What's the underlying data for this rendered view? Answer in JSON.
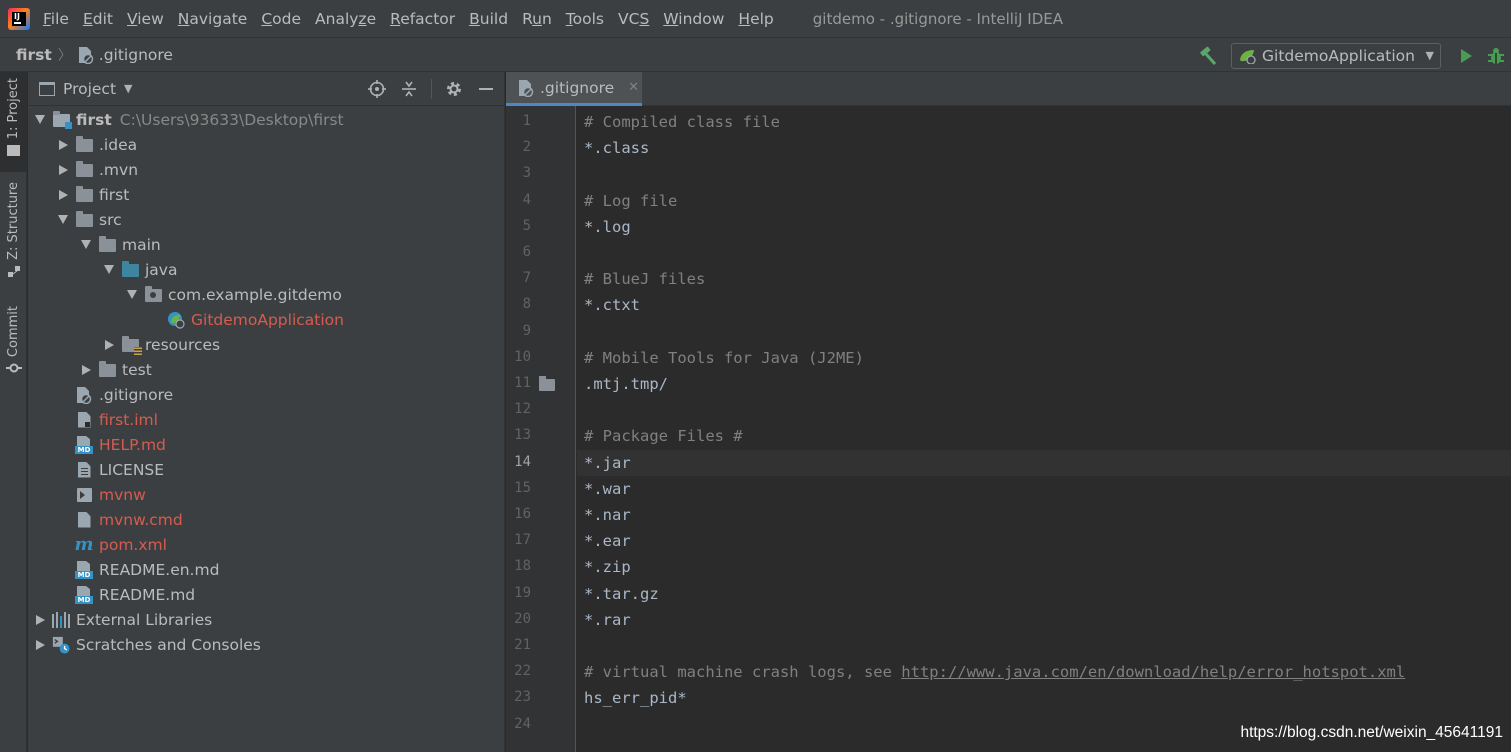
{
  "menubar": {
    "items": [
      {
        "pre": "",
        "mn": "F",
        "post": "ile"
      },
      {
        "pre": "",
        "mn": "E",
        "post": "dit"
      },
      {
        "pre": "",
        "mn": "V",
        "post": "iew"
      },
      {
        "pre": "",
        "mn": "N",
        "post": "avigate"
      },
      {
        "pre": "",
        "mn": "C",
        "post": "ode"
      },
      {
        "pre": "Analy",
        "mn": "z",
        "post": "e"
      },
      {
        "pre": "",
        "mn": "R",
        "post": "efactor"
      },
      {
        "pre": "",
        "mn": "B",
        "post": "uild"
      },
      {
        "pre": "R",
        "mn": "u",
        "post": "n"
      },
      {
        "pre": "",
        "mn": "T",
        "post": "ools"
      },
      {
        "pre": "VC",
        "mn": "S",
        "post": ""
      },
      {
        "pre": "",
        "mn": "W",
        "post": "indow"
      },
      {
        "pre": "",
        "mn": "H",
        "post": "elp"
      }
    ],
    "window_title": "gitdemo - .gitignore - IntelliJ IDEA"
  },
  "navbar": {
    "root": "first",
    "file": ".gitignore",
    "run_config": "GitdemoApplication"
  },
  "toolstripe": {
    "project": "1: Project",
    "structure": "Z: Structure",
    "commit": "Commit"
  },
  "project_panel": {
    "title": "Project",
    "tree": [
      {
        "label": "first",
        "path": "C:\\Users\\93633\\Desktop\\first",
        "depth": 0,
        "arrow": "down",
        "icon": "module-folder-icon",
        "bold": true
      },
      {
        "label": ".idea",
        "depth": 1,
        "arrow": "right",
        "icon": "folder-icon"
      },
      {
        "label": ".mvn",
        "depth": 1,
        "arrow": "right",
        "icon": "folder-icon"
      },
      {
        "label": "first",
        "depth": 1,
        "arrow": "right",
        "icon": "folder-icon"
      },
      {
        "label": "src",
        "depth": 1,
        "arrow": "down",
        "icon": "folder-icon"
      },
      {
        "label": "main",
        "depth": 2,
        "arrow": "down",
        "icon": "folder-icon"
      },
      {
        "label": "java",
        "depth": 3,
        "arrow": "down",
        "icon": "source-folder-icon"
      },
      {
        "label": "com.example.gitdemo",
        "depth": 4,
        "arrow": "down",
        "icon": "package-icon"
      },
      {
        "label": "GitdemoApplication",
        "depth": 5,
        "arrow": "none",
        "icon": "spring-class-icon",
        "red": true
      },
      {
        "label": "resources",
        "depth": 3,
        "arrow": "right",
        "icon": "resources-folder-icon"
      },
      {
        "label": "test",
        "depth": 2,
        "arrow": "right",
        "icon": "folder-icon"
      },
      {
        "label": ".gitignore",
        "depth": 1,
        "arrow": "none",
        "icon": "ignore-file-icon"
      },
      {
        "label": "first.iml",
        "depth": 1,
        "arrow": "none",
        "icon": "iml-file-icon",
        "red": true
      },
      {
        "label": "HELP.md",
        "depth": 1,
        "arrow": "none",
        "icon": "markdown-icon",
        "red": true
      },
      {
        "label": "LICENSE",
        "depth": 1,
        "arrow": "none",
        "icon": "text-file-icon"
      },
      {
        "label": "mvnw",
        "depth": 1,
        "arrow": "none",
        "icon": "shell-script-icon",
        "red": true
      },
      {
        "label": "mvnw.cmd",
        "depth": 1,
        "arrow": "none",
        "icon": "file-icon",
        "red": true
      },
      {
        "label": "pom.xml",
        "depth": 1,
        "arrow": "none",
        "icon": "maven-icon",
        "red": true
      },
      {
        "label": "README.en.md",
        "depth": 1,
        "arrow": "none",
        "icon": "markdown-icon"
      },
      {
        "label": "README.md",
        "depth": 1,
        "arrow": "none",
        "icon": "markdown-icon"
      },
      {
        "label": "External Libraries",
        "depth": 0,
        "arrow": "right",
        "icon": "library-icon"
      },
      {
        "label": "Scratches and Consoles",
        "depth": 0,
        "arrow": "right",
        "icon": "scratches-icon"
      }
    ]
  },
  "editor": {
    "tab_label": ".gitignore",
    "current_line": 14,
    "lines": [
      {
        "text": "# Compiled class file",
        "type": "comment"
      },
      {
        "text": "*.class",
        "type": "code"
      },
      {
        "text": "",
        "type": "code"
      },
      {
        "text": "# Log file",
        "type": "comment"
      },
      {
        "text": "*.log",
        "type": "code"
      },
      {
        "text": "",
        "type": "code"
      },
      {
        "text": "# BlueJ files",
        "type": "comment"
      },
      {
        "text": "*.ctxt",
        "type": "code"
      },
      {
        "text": "",
        "type": "code"
      },
      {
        "text": "# Mobile Tools for Java (J2ME)",
        "type": "comment"
      },
      {
        "text": ".mtj.tmp/",
        "type": "code"
      },
      {
        "text": "",
        "type": "code"
      },
      {
        "text": "# Package Files #",
        "type": "comment"
      },
      {
        "text": "*.jar",
        "type": "code"
      },
      {
        "text": "*.war",
        "type": "code"
      },
      {
        "text": "*.nar",
        "type": "code"
      },
      {
        "text": "*.ear",
        "type": "code"
      },
      {
        "text": "*.zip",
        "type": "code"
      },
      {
        "text": "*.tar.gz",
        "type": "code"
      },
      {
        "text": "*.rar",
        "type": "code"
      },
      {
        "text": "",
        "type": "code"
      },
      {
        "text": "# virtual machine crash logs, see ",
        "type": "comment",
        "url": "http://www.java.com/en/download/help/error_hotspot.xml"
      },
      {
        "text": "hs_err_pid*",
        "type": "code"
      },
      {
        "text": "",
        "type": "code"
      }
    ]
  },
  "watermark": "https://blog.csdn.net/weixin_45641191"
}
